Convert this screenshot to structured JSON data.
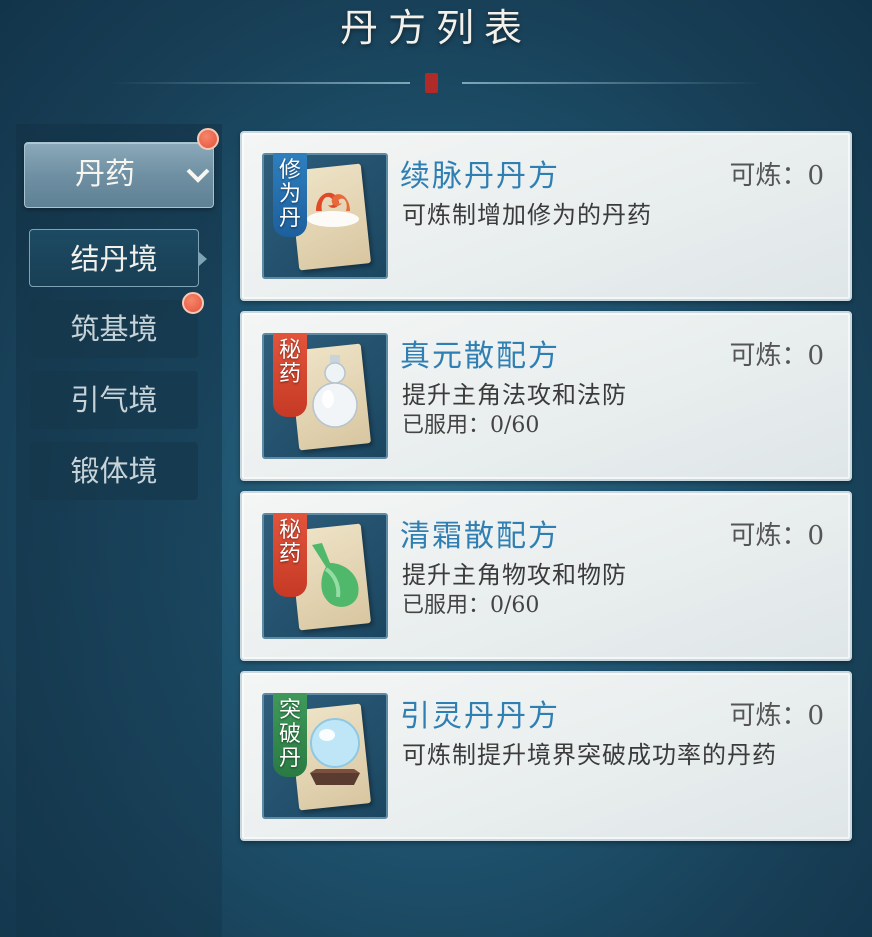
{
  "title": "丹方列表",
  "sidebar": {
    "dropdown_label": "丹药",
    "realms": [
      "结丹境",
      "筑基境",
      "引气境",
      "锻体境"
    ]
  },
  "recipes": [
    {
      "name": "续脉丹丹方",
      "count": "可炼：0",
      "desc": "可炼制增加修为的丹药",
      "used": "",
      "tag": "修为丹",
      "tag_color": "#2f7fbf",
      "icon": "red-swirl-pill-icon"
    },
    {
      "name": "真元散配方",
      "count": "可炼：0",
      "desc": "提升主角法攻和法防",
      "used": "已服用：0/60",
      "tag": "秘药",
      "tag_color": "#e2543b",
      "icon": "white-gourd-bottle-icon"
    },
    {
      "name": "清霜散配方",
      "count": "可炼：0",
      "desc": "提升主角物攻和物防",
      "used": "已服用：0/60",
      "tag": "秘药",
      "tag_color": "#e2543b",
      "icon": "green-gourd-bottle-icon"
    },
    {
      "name": "引灵丹丹方",
      "count": "可炼：0",
      "desc": "可炼制提升境界突破成功率的丹药",
      "used": "",
      "tag": "突破丹",
      "tag_color": "#3f9a5a",
      "icon": "crystal-orb-icon"
    }
  ]
}
